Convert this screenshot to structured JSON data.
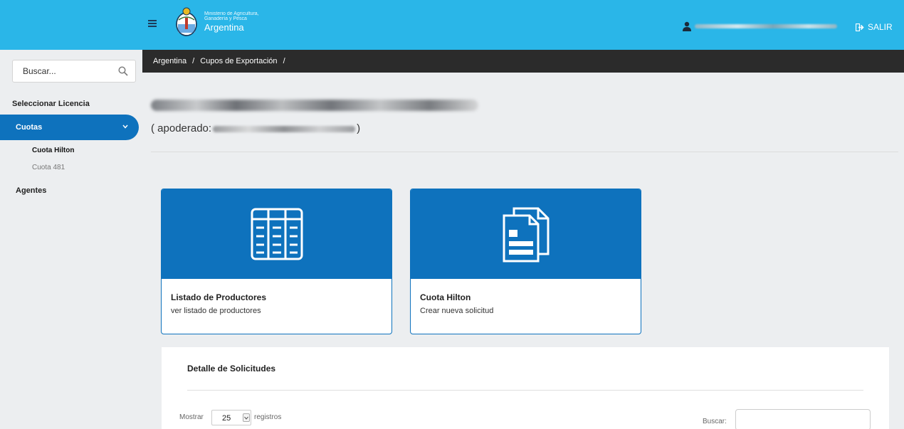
{
  "header": {
    "logo_line1": "Ministerio de Agricultura,",
    "logo_line2": "Ganadería y Pesca",
    "logo_brand": "Argentina",
    "logout_label": "SALIR"
  },
  "sidebar": {
    "search_placeholder": "Buscar...",
    "items": [
      {
        "label": "Seleccionar Licencia"
      },
      {
        "label": "Cuotas",
        "active": true,
        "children": [
          {
            "label": "Cuota Hilton",
            "selected": true
          },
          {
            "label": "Cuota 481"
          }
        ]
      },
      {
        "label": "Agentes"
      }
    ]
  },
  "breadcrumb": {
    "items": [
      "Argentina",
      "Cupos de Exportación"
    ],
    "separator": "/"
  },
  "main": {
    "apoderado_prefix": "( apoderado:",
    "apoderado_suffix": ")",
    "cards": [
      {
        "title": "Listado de Productores",
        "subtitle": "ver listado de productores",
        "icon": "table-icon"
      },
      {
        "title": "Cuota Hilton",
        "subtitle": "Crear nueva solicitud",
        "icon": "documents-icon"
      }
    ],
    "details": {
      "title": "Detalle de Solicitudes",
      "show_label": "Mostrar",
      "page_size": "25",
      "records_label": "registros",
      "search_label": "Buscar:"
    }
  },
  "colors": {
    "topbar": "#2ab6e8",
    "primary": "#0e72bd",
    "breadcrumb_bg": "#2b2b2b"
  }
}
